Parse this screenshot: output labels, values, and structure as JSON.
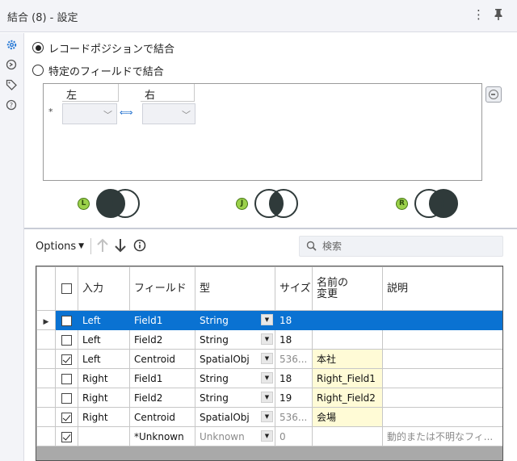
{
  "header": {
    "title": "結合 (8) - 設定",
    "more_icon": "more-vert-icon",
    "pin_icon": "pin-icon"
  },
  "rail": {
    "icons": [
      "gear-icon",
      "connection-icon",
      "tag-icon",
      "help-icon"
    ]
  },
  "mode": {
    "position_label": "レコードポジションで結合",
    "field_label": "特定のフィールドで結合",
    "selected": "position"
  },
  "join_fields": {
    "left_header": "左",
    "right_header": "右",
    "new_row_marker": "*"
  },
  "venn": {
    "left_tag": "L",
    "join_tag": "J",
    "right_tag": "R"
  },
  "colors": {
    "selection": "#0a72d2",
    "rename_bg": "#fffbd6",
    "venn_dark": "#2f3a3a",
    "tag_green": "#9bd14a"
  },
  "toolbar": {
    "options_label": "Options",
    "search_placeholder": "検索"
  },
  "table": {
    "headers": {
      "input": "入力",
      "field": "フィールド",
      "type": "型",
      "size": "サイズ",
      "rename": "名前の変更",
      "description": "説明"
    },
    "rows": [
      {
        "checked": false,
        "input": "Left",
        "field": "Field1",
        "type": "String",
        "size": "18",
        "rename": "",
        "description": ""
      },
      {
        "checked": false,
        "input": "Left",
        "field": "Field2",
        "type": "String",
        "size": "18",
        "rename": "",
        "description": ""
      },
      {
        "checked": true,
        "input": "Left",
        "field": "Centroid",
        "type": "SpatialObj",
        "size": "536...",
        "rename": "本社",
        "description": ""
      },
      {
        "checked": false,
        "input": "Right",
        "field": "Field1",
        "type": "String",
        "size": "18",
        "rename": "Right_Field1",
        "description": ""
      },
      {
        "checked": false,
        "input": "Right",
        "field": "Field2",
        "type": "String",
        "size": "19",
        "rename": "Right_Field2",
        "description": ""
      },
      {
        "checked": true,
        "input": "Right",
        "field": "Centroid",
        "type": "SpatialObj",
        "size": "536...",
        "rename": "会場",
        "description": ""
      },
      {
        "checked": true,
        "input": "",
        "field": "*Unknown",
        "type": "Unknown",
        "size": "0",
        "rename": "",
        "description": "動的または不明なフィ..."
      }
    ]
  }
}
